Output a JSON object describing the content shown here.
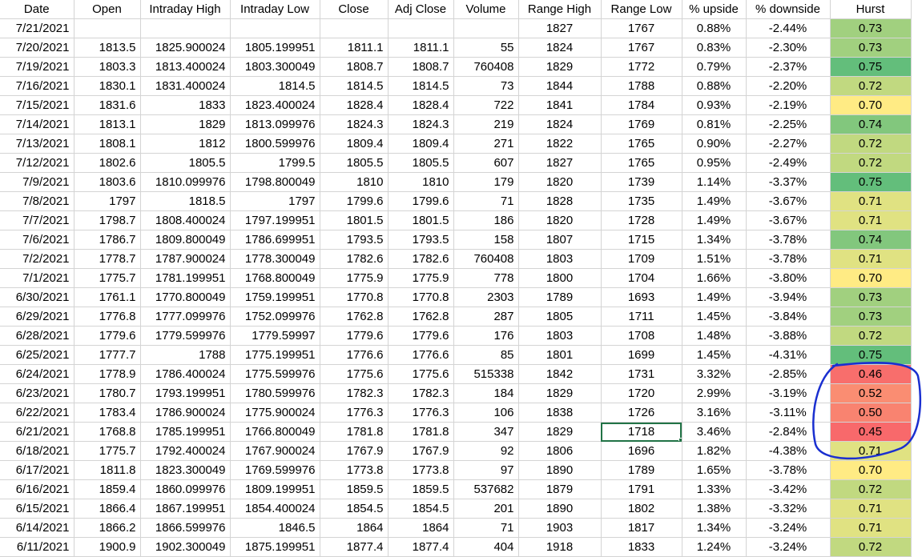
{
  "headers": [
    "Date",
    "Open",
    "Intraday High",
    "Intraday Low",
    "Close",
    "Adj Close",
    "Volume",
    "Range High",
    "Range Low",
    "% upside",
    "% downside",
    "Hurst"
  ],
  "rows": [
    [
      "7/21/2021",
      "",
      "",
      "",
      "",
      "",
      "",
      "1827",
      "1767",
      "0.88%",
      "-2.44%",
      "0.73"
    ],
    [
      "7/20/2021",
      "1813.5",
      "1825.900024",
      "1805.199951",
      "1811.1",
      "1811.1",
      "55",
      "1824",
      "1767",
      "0.83%",
      "-2.30%",
      "0.73"
    ],
    [
      "7/19/2021",
      "1803.3",
      "1813.400024",
      "1803.300049",
      "1808.7",
      "1808.7",
      "760408",
      "1829",
      "1772",
      "0.79%",
      "-2.37%",
      "0.75"
    ],
    [
      "7/16/2021",
      "1830.1",
      "1831.400024",
      "1814.5",
      "1814.5",
      "1814.5",
      "73",
      "1844",
      "1788",
      "0.88%",
      "-2.20%",
      "0.72"
    ],
    [
      "7/15/2021",
      "1831.6",
      "1833",
      "1823.400024",
      "1828.4",
      "1828.4",
      "722",
      "1841",
      "1784",
      "0.93%",
      "-2.19%",
      "0.70"
    ],
    [
      "7/14/2021",
      "1813.1",
      "1829",
      "1813.099976",
      "1824.3",
      "1824.3",
      "219",
      "1824",
      "1769",
      "0.81%",
      "-2.25%",
      "0.74"
    ],
    [
      "7/13/2021",
      "1808.1",
      "1812",
      "1800.599976",
      "1809.4",
      "1809.4",
      "271",
      "1822",
      "1765",
      "0.90%",
      "-2.27%",
      "0.72"
    ],
    [
      "7/12/2021",
      "1802.6",
      "1805.5",
      "1799.5",
      "1805.5",
      "1805.5",
      "607",
      "1827",
      "1765",
      "0.95%",
      "-2.49%",
      "0.72"
    ],
    [
      "7/9/2021",
      "1803.6",
      "1810.099976",
      "1798.800049",
      "1810",
      "1810",
      "179",
      "1820",
      "1739",
      "1.14%",
      "-3.37%",
      "0.75"
    ],
    [
      "7/8/2021",
      "1797",
      "1818.5",
      "1797",
      "1799.6",
      "1799.6",
      "71",
      "1828",
      "1735",
      "1.49%",
      "-3.67%",
      "0.71"
    ],
    [
      "7/7/2021",
      "1798.7",
      "1808.400024",
      "1797.199951",
      "1801.5",
      "1801.5",
      "186",
      "1820",
      "1728",
      "1.49%",
      "-3.67%",
      "0.71"
    ],
    [
      "7/6/2021",
      "1786.7",
      "1809.800049",
      "1786.699951",
      "1793.5",
      "1793.5",
      "158",
      "1807",
      "1715",
      "1.34%",
      "-3.78%",
      "0.74"
    ],
    [
      "7/2/2021",
      "1778.7",
      "1787.900024",
      "1778.300049",
      "1782.6",
      "1782.6",
      "760408",
      "1803",
      "1709",
      "1.51%",
      "-3.78%",
      "0.71"
    ],
    [
      "7/1/2021",
      "1775.7",
      "1781.199951",
      "1768.800049",
      "1775.9",
      "1775.9",
      "778",
      "1800",
      "1704",
      "1.66%",
      "-3.80%",
      "0.70"
    ],
    [
      "6/30/2021",
      "1761.1",
      "1770.800049",
      "1759.199951",
      "1770.8",
      "1770.8",
      "2303",
      "1789",
      "1693",
      "1.49%",
      "-3.94%",
      "0.73"
    ],
    [
      "6/29/2021",
      "1776.8",
      "1777.099976",
      "1752.099976",
      "1762.8",
      "1762.8",
      "287",
      "1805",
      "1711",
      "1.45%",
      "-3.84%",
      "0.73"
    ],
    [
      "6/28/2021",
      "1779.6",
      "1779.599976",
      "1779.59997",
      "1779.6",
      "1779.6",
      "176",
      "1803",
      "1708",
      "1.48%",
      "-3.88%",
      "0.72"
    ],
    [
      "6/25/2021",
      "1777.7",
      "1788",
      "1775.199951",
      "1776.6",
      "1776.6",
      "85",
      "1801",
      "1699",
      "1.45%",
      "-4.31%",
      "0.75"
    ],
    [
      "6/24/2021",
      "1778.9",
      "1786.400024",
      "1775.599976",
      "1775.6",
      "1775.6",
      "515338",
      "1842",
      "1731",
      "3.32%",
      "-2.85%",
      "0.46"
    ],
    [
      "6/23/2021",
      "1780.7",
      "1793.199951",
      "1780.599976",
      "1782.3",
      "1782.3",
      "184",
      "1829",
      "1720",
      "2.99%",
      "-3.19%",
      "0.52"
    ],
    [
      "6/22/2021",
      "1783.4",
      "1786.900024",
      "1775.900024",
      "1776.3",
      "1776.3",
      "106",
      "1838",
      "1726",
      "3.16%",
      "-3.11%",
      "0.50"
    ],
    [
      "6/21/2021",
      "1768.8",
      "1785.199951",
      "1766.800049",
      "1781.8",
      "1781.8",
      "347",
      "1829",
      "1718",
      "3.46%",
      "-2.84%",
      "0.45"
    ],
    [
      "6/18/2021",
      "1775.7",
      "1792.400024",
      "1767.900024",
      "1767.9",
      "1767.9",
      "92",
      "1806",
      "1696",
      "1.82%",
      "-4.38%",
      "0.71"
    ],
    [
      "6/17/2021",
      "1811.8",
      "1823.300049",
      "1769.599976",
      "1773.8",
      "1773.8",
      "97",
      "1890",
      "1789",
      "1.65%",
      "-3.78%",
      "0.70"
    ],
    [
      "6/16/2021",
      "1859.4",
      "1860.099976",
      "1809.199951",
      "1859.5",
      "1859.5",
      "537682",
      "1879",
      "1791",
      "1.33%",
      "-3.42%",
      "0.72"
    ],
    [
      "6/15/2021",
      "1866.4",
      "1867.199951",
      "1854.400024",
      "1854.5",
      "1854.5",
      "201",
      "1890",
      "1802",
      "1.38%",
      "-3.32%",
      "0.71"
    ],
    [
      "6/14/2021",
      "1866.2",
      "1866.599976",
      "1846.5",
      "1864",
      "1864",
      "71",
      "1903",
      "1817",
      "1.34%",
      "-3.24%",
      "0.71"
    ],
    [
      "6/11/2021",
      "1900.9",
      "1902.300049",
      "1875.199951",
      "1877.4",
      "1877.4",
      "404",
      "1918",
      "1833",
      "1.24%",
      "-3.24%",
      "0.72"
    ]
  ],
  "selected_cell": {
    "row": 21,
    "col": 8
  },
  "annotation_color": "#1a2fd0"
}
